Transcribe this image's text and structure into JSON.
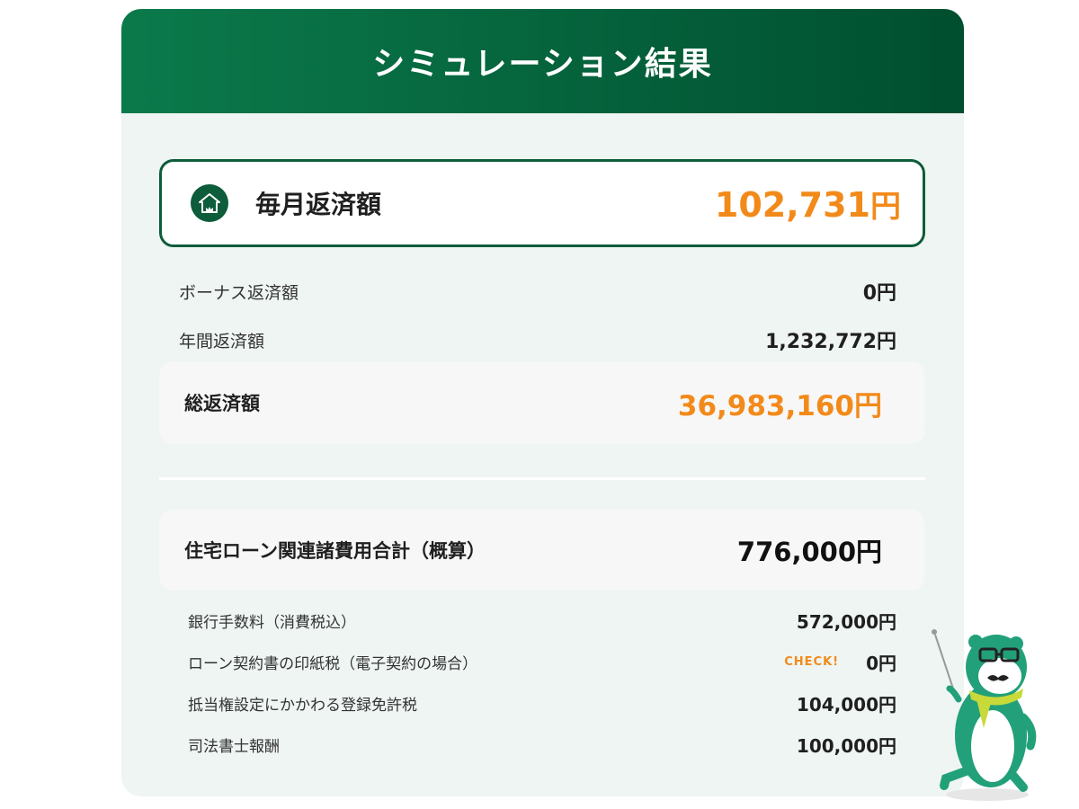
{
  "header": {
    "title": "シミュレーション結果"
  },
  "monthly": {
    "label": "毎月返済額",
    "amount": "102,731",
    "unit": "円",
    "icon": "house-icon"
  },
  "summary_rows": [
    {
      "label": "ボーナス返済額",
      "value": "0円"
    },
    {
      "label": "年間返済額",
      "value": "1,232,772円"
    }
  ],
  "total": {
    "label": "総返済額",
    "value": "36,983,160円"
  },
  "fees": {
    "label": "住宅ローン関連諸費用合計（概算）",
    "value": "776,000円",
    "items": [
      {
        "label": "銀行手数料（消費税込）",
        "value": "572,000円"
      },
      {
        "label": "ローン契約書の印紙税（電子契約の場合）",
        "value": "0円",
        "badge": "CHECK!"
      },
      {
        "label": "抵当権設定にかかわる登録免許税",
        "value": "104,000円"
      },
      {
        "label": "司法書士報酬",
        "value": "100,000円"
      }
    ]
  },
  "colors": {
    "header_start": "#0b7a4b",
    "header_end": "#004f2f",
    "accent": "#f28a1a",
    "card_bg": "#eef5f2",
    "border": "#0d5c3a"
  }
}
